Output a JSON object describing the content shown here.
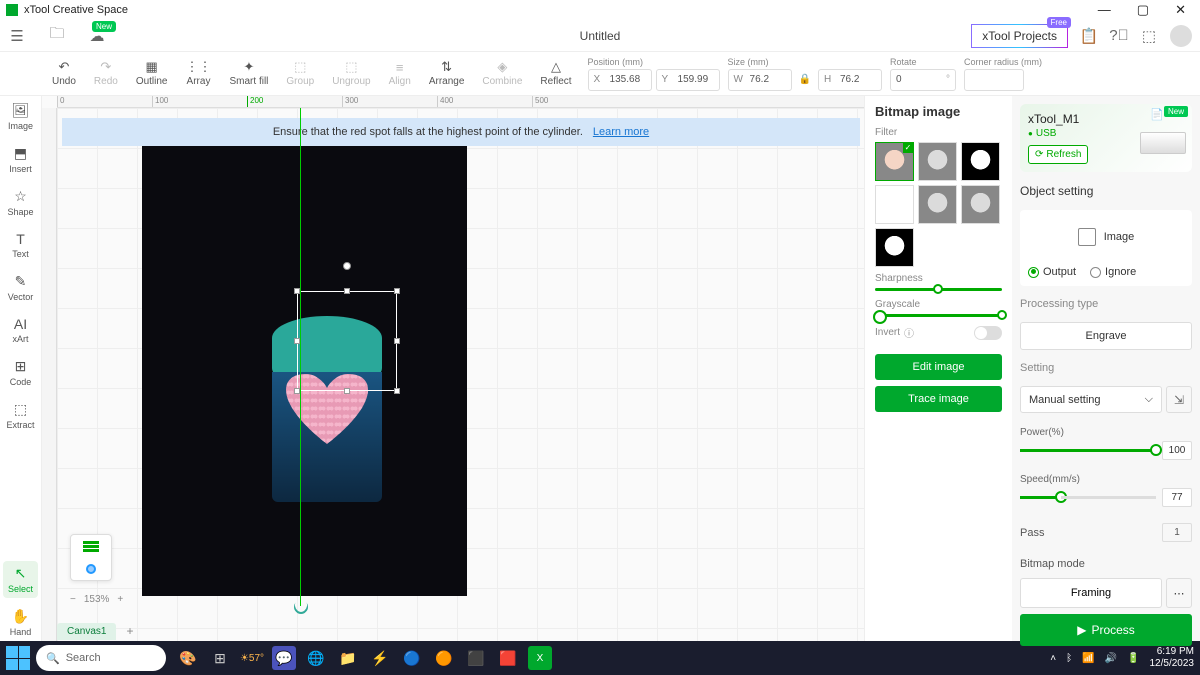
{
  "app": {
    "title": "xTool Creative Space"
  },
  "window": {
    "minimize": "—",
    "maximize": "▢",
    "close": "✕"
  },
  "menubar": {
    "doc_title": "Untitled",
    "projects_label": "xTool Projects",
    "projects_badge": "Free",
    "new_badge": "New"
  },
  "toolbar": {
    "undo": "Undo",
    "redo": "Redo",
    "outline": "Outline",
    "array": "Array",
    "smartfill": "Smart fill",
    "group": "Group",
    "ungroup": "Ungroup",
    "align": "Align",
    "arrange": "Arrange",
    "combine": "Combine",
    "reflect": "Reflect",
    "position_label": "Position (mm)",
    "x_prefix": "X",
    "x_val": "135.68",
    "y_prefix": "Y",
    "y_val": "159.99",
    "size_label": "Size (mm)",
    "w_prefix": "W",
    "w_val": "76.2",
    "h_prefix": "H",
    "h_val": "76.2",
    "rotate_label": "Rotate",
    "rotate_val": "0",
    "corner_label": "Corner radius (mm)"
  },
  "sidebar": {
    "items": [
      {
        "label": "Image"
      },
      {
        "label": "Insert"
      },
      {
        "label": "Shape"
      },
      {
        "label": "Text"
      },
      {
        "label": "Vector"
      },
      {
        "label": "xArt"
      },
      {
        "label": "Code"
      },
      {
        "label": "Extract"
      },
      {
        "label": "Select"
      },
      {
        "label": "Hand"
      }
    ]
  },
  "canvas": {
    "banner_text": "Ensure that the red spot falls at the highest point of the cylinder.",
    "banner_link": "Learn more",
    "zoom": "153%",
    "tab": "Canvas1",
    "ruler": [
      "0",
      "100",
      "200",
      "300",
      "400",
      "500"
    ]
  },
  "bitmap": {
    "title": "Bitmap image",
    "filter_label": "Filter",
    "sharpness_label": "Sharpness",
    "grayscale_label": "Grayscale",
    "invert_label": "Invert",
    "edit_btn": "Edit image",
    "trace_btn": "Trace image"
  },
  "settings": {
    "device_name": "xTool_M1",
    "device_status": "USB",
    "refresh": "Refresh",
    "device_badge": "New",
    "object_setting": "Object setting",
    "obj_type": "Image",
    "output": "Output",
    "ignore": "Ignore",
    "processing_type": "Processing type",
    "engrave": "Engrave",
    "setting_label": "Setting",
    "manual": "Manual setting",
    "power_label": "Power(%)",
    "power_val": "100",
    "speed_label": "Speed(mm/s)",
    "speed_val": "77",
    "pass_label": "Pass",
    "pass_val": "1",
    "bitmap_mode": "Bitmap mode",
    "framing": "Framing",
    "process": "Process"
  },
  "taskbar": {
    "search_placeholder": "Search",
    "weather": "57°",
    "time": "6:19 PM",
    "date": "12/5/2023"
  }
}
